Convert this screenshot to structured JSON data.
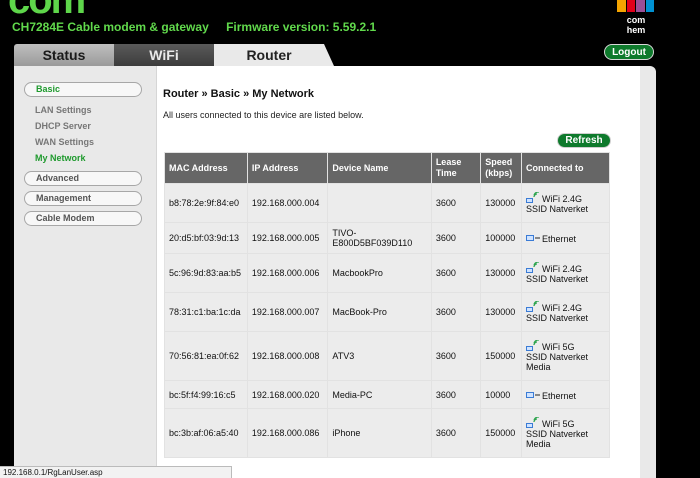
{
  "header": {
    "logo_fragment": "com",
    "device": "CH7284E Cable modem & gateway",
    "firmware": "Firmware version: 5.59.2.1",
    "brand_name": "com hem",
    "brand_colors": [
      "#f4a400",
      "#e2001a",
      "#9b4f97",
      "#0091d2"
    ]
  },
  "tabs": [
    {
      "label": "Status"
    },
    {
      "label": "WiFi"
    },
    {
      "label": "Router"
    }
  ],
  "logout_label": "Logout",
  "sidebar": {
    "basic": {
      "label": "Basic",
      "items": [
        {
          "label": "LAN Settings"
        },
        {
          "label": "DHCP Server"
        },
        {
          "label": "WAN Settings"
        },
        {
          "label": "My Network"
        }
      ]
    },
    "advanced": "Advanced",
    "management": "Management",
    "cable_modem": "Cable Modem"
  },
  "content": {
    "breadcrumb": "Router » Basic » My Network",
    "intro": "All users connected to this device are listed below.",
    "refresh_label": "Refresh"
  },
  "table": {
    "headers": [
      "MAC Address",
      "IP Address",
      "Device Name",
      "Lease Time",
      "Speed (kbps)",
      "Connected to"
    ],
    "rows": [
      {
        "mac": "b8:78:2e:9f:84:e0",
        "ip": "192.168.000.004",
        "name": "",
        "lease": "3600",
        "speed": "130000",
        "conn": [
          "WiFi 2.4G",
          "SSID Natverket"
        ],
        "icon": "wifi"
      },
      {
        "mac": "20:d5:bf:03:9d:13",
        "ip": "192.168.000.005",
        "name": "TIVO-E800D5BF039D110",
        "lease": "3600",
        "speed": "100000",
        "conn": [
          "Ethernet"
        ],
        "icon": "ethernet"
      },
      {
        "mac": "5c:96:9d:83:aa:b5",
        "ip": "192.168.000.006",
        "name": "MacbookPro",
        "lease": "3600",
        "speed": "130000",
        "conn": [
          "WiFi 2.4G",
          "SSID Natverket"
        ],
        "icon": "wifi"
      },
      {
        "mac": "78:31:c1:ba:1c:da",
        "ip": "192.168.000.007",
        "name": "MacBook-Pro",
        "lease": "3600",
        "speed": "130000",
        "conn": [
          "WiFi 2.4G",
          "SSID Natverket"
        ],
        "icon": "wifi"
      },
      {
        "mac": "70:56:81:ea:0f:62",
        "ip": "192.168.000.008",
        "name": "ATV3",
        "lease": "3600",
        "speed": "150000",
        "conn": [
          "WiFi 5G",
          "SSID Natverket",
          "Media"
        ],
        "icon": "wifi"
      },
      {
        "mac": "bc:5f:f4:99:16:c5",
        "ip": "192.168.000.020",
        "name": "Media-PC",
        "lease": "3600",
        "speed": "10000",
        "conn": [
          "Ethernet"
        ],
        "icon": "ethernet"
      },
      {
        "mac": "bc:3b:af:06:a5:40",
        "ip": "192.168.000.086",
        "name": "iPhone",
        "lease": "3600",
        "speed": "150000",
        "conn": [
          "WiFi 5G",
          "SSID Natverket",
          "Media"
        ],
        "icon": "wifi"
      }
    ]
  },
  "statusbar": "192.168.0.1/RgLanUser.asp"
}
